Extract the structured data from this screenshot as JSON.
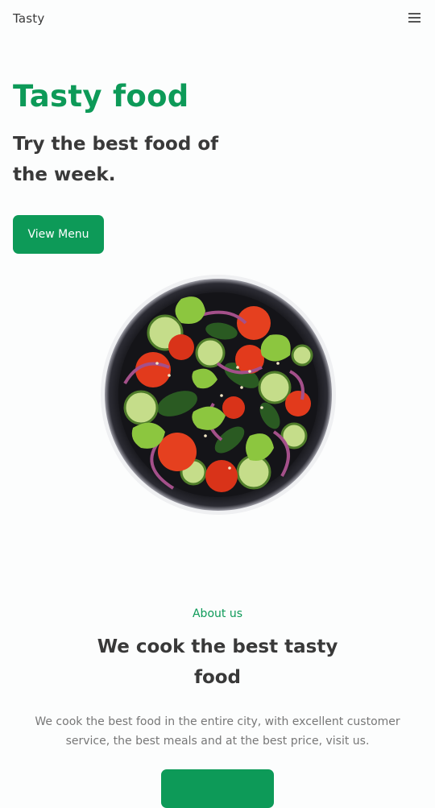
{
  "header": {
    "logo": "Tasty",
    "menu_icon": "hamburger-menu-icon"
  },
  "hero": {
    "title": "Tasty food",
    "subtitle": "Try the best food of the week.",
    "button_label": "View Menu",
    "image_alt": "salad-bowl-image"
  },
  "about": {
    "kicker": "About us",
    "title": "We cook the best tasty food",
    "text": "We cook the best food in the entire city, with excellent customer service, the best meals and at the best price, visit us.",
    "button_label": ""
  },
  "colors": {
    "accent": "#0d9a58",
    "text": "#393939",
    "muted": "#777777",
    "background": "#fcfdfd"
  }
}
